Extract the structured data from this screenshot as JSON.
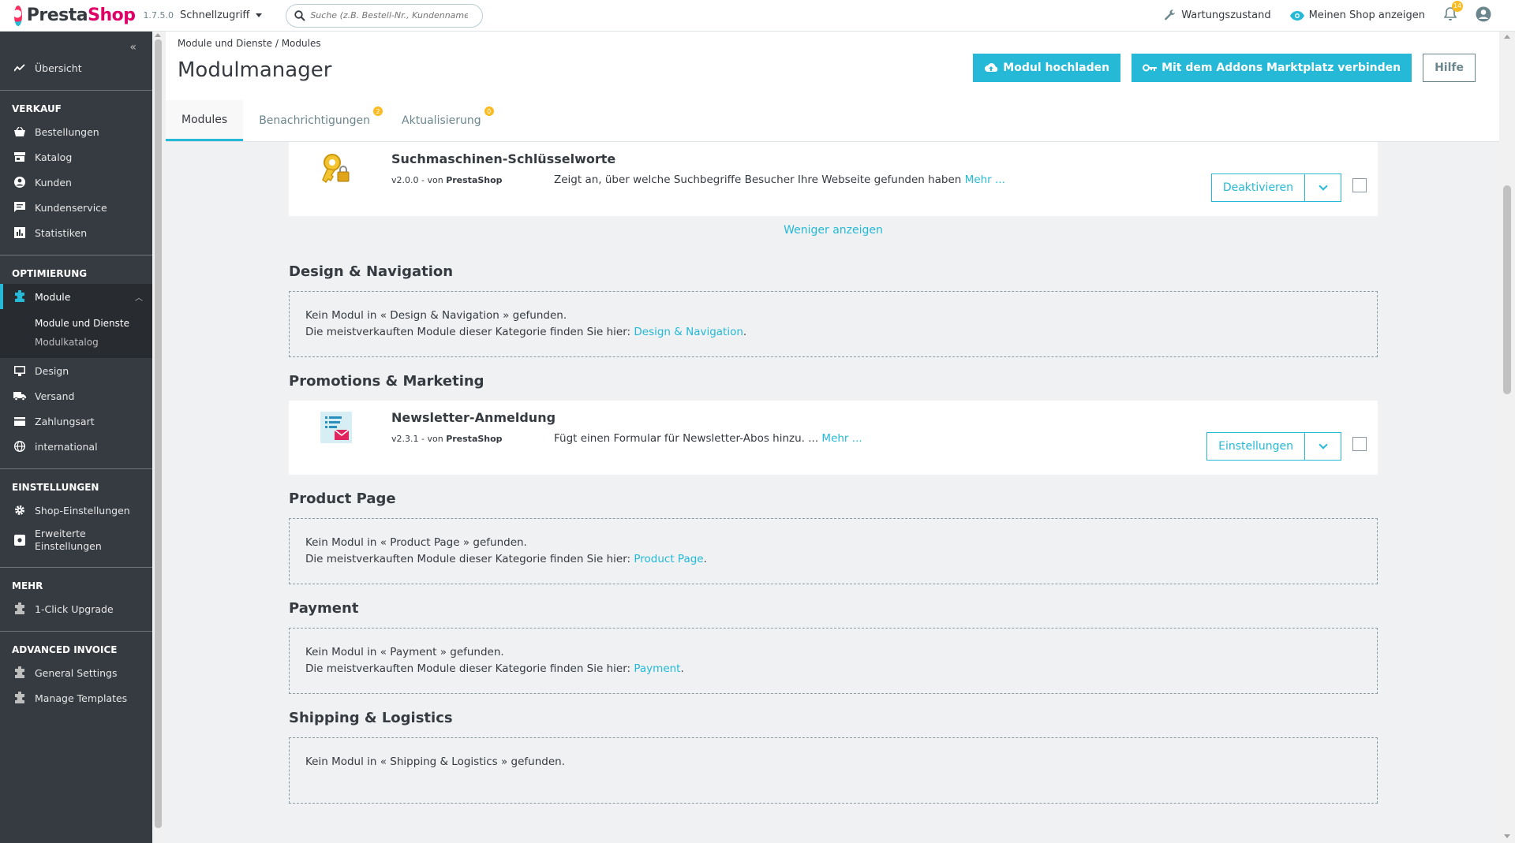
{
  "header": {
    "logo_text_a": "Presta",
    "logo_text_b": "Shop",
    "version": "1.7.5.0",
    "quick_access": "Schnellzugriff",
    "search_placeholder": "Suche (z.B. Bestell-Nr., Kundenname ...)",
    "maintenance": "Wartungszustand",
    "view_shop": "Meinen Shop anzeigen",
    "notifications_count": "14"
  },
  "sidebar": {
    "overview": "Übersicht",
    "sections": {
      "sales": "VERKAUF",
      "optimization": "OPTIMIERUNG",
      "settings": "EINSTELLUNGEN",
      "more": "MEHR",
      "advanced_invoice": "ADVANCED INVOICE"
    },
    "sales_items": [
      "Bestellungen",
      "Katalog",
      "Kunden",
      "Kundenservice",
      "Statistiken"
    ],
    "modules": "Module",
    "module_sub": [
      "Module und Dienste",
      "Modulkatalog"
    ],
    "opt_items": [
      "Design",
      "Versand",
      "Zahlungsart",
      "international"
    ],
    "settings_items": [
      "Shop-Einstellungen",
      "Erweiterte",
      "Einstellungen"
    ],
    "more_items": [
      "1-Click Upgrade"
    ],
    "invoice_items": [
      "General Settings",
      "Manage Templates"
    ]
  },
  "page": {
    "breadcrumb_parent": "Module und Dienste",
    "breadcrumb_sep": "/",
    "breadcrumb_current": "Modules",
    "title": "Modulmanager",
    "btn_upload": "Modul hochladen",
    "btn_connect": "Mit dem Addons Marktplatz verbinden",
    "btn_help": "Hilfe",
    "tabs": [
      "Modules",
      "Benachrichtigungen",
      "Aktualisierung"
    ],
    "tab_badges": [
      "2",
      "0"
    ]
  },
  "modules": {
    "seo": {
      "name": "Suchmaschinen-Schlüsselworte",
      "version": "v2.0.0 - von",
      "author": "PrestaShop",
      "desc": "Zeigt an, über welche Suchbegriffe Besucher Ihre Webseite gefunden haben",
      "more": "Mehr ...",
      "action": "Deaktivieren"
    },
    "show_less": "Weniger anzeigen",
    "newsletter": {
      "name": "Newsletter-Anmeldung",
      "version": "v2.3.1 - von",
      "author": "PrestaShop",
      "desc": "Fügt einen Formular für Newsletter-Abos hinzu. ...",
      "more": "Mehr ...",
      "action": "Einstellungen"
    }
  },
  "categories": {
    "design": {
      "title": "Design & Navigation",
      "line1": "Kein Modul in « Design & Navigation » gefunden.",
      "line2": "Die meistverkauften Module dieser Kategorie finden Sie hier:",
      "link": "Design & Navigation"
    },
    "promotions": {
      "title": "Promotions & Marketing"
    },
    "product": {
      "title": "Product Page",
      "line1": "Kein Modul in « Product Page » gefunden.",
      "line2": "Die meistverkauften Module dieser Kategorie finden Sie hier:",
      "link": "Product Page"
    },
    "payment": {
      "title": "Payment",
      "line1": "Kein Modul in « Payment » gefunden.",
      "line2": "Die meistverkauften Module dieser Kategorie finden Sie hier:",
      "link": "Payment"
    },
    "shipping": {
      "title": "Shipping & Logistics",
      "line1": "Kein Modul in « Shipping & Logistics » gefunden."
    }
  },
  "colors": {
    "accent": "#25b9d7",
    "sidebar_bg": "#363a41",
    "badge": "#fbbb22",
    "brand": "#df0067"
  }
}
